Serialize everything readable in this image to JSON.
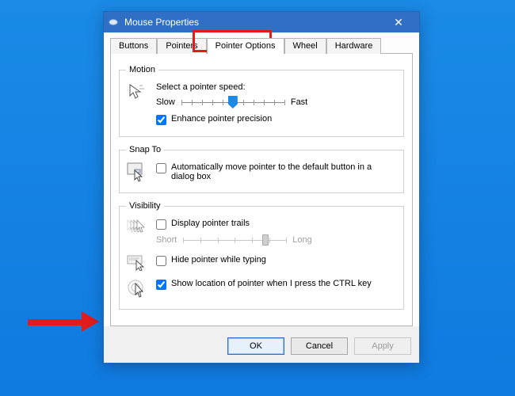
{
  "window": {
    "title": "Mouse Properties",
    "close_glyph": "✕"
  },
  "tabs": {
    "items": [
      {
        "label": "Buttons"
      },
      {
        "label": "Pointers"
      },
      {
        "label": "Pointer Options"
      },
      {
        "label": "Wheel"
      },
      {
        "label": "Hardware"
      }
    ],
    "active_index": 2
  },
  "motion": {
    "legend": "Motion",
    "heading": "Select a pointer speed:",
    "slow": "Slow",
    "fast": "Fast",
    "speed_value": 5,
    "speed_min": 0,
    "speed_max": 10,
    "enhance_label": "Enhance pointer precision",
    "enhance_checked": true
  },
  "snap": {
    "legend": "Snap To",
    "auto_label": "Automatically move pointer to the default button in a dialog box",
    "auto_checked": false
  },
  "visibility": {
    "legend": "Visibility",
    "trails_label": "Display pointer trails",
    "trails_checked": false,
    "short": "Short",
    "long": "Long",
    "trails_value": 8,
    "trails_min": 0,
    "trails_max": 10,
    "hide_label": "Hide pointer while typing",
    "hide_checked": false,
    "ctrl_label": "Show location of pointer when I press the CTRL key",
    "ctrl_checked": true
  },
  "buttons": {
    "ok": "OK",
    "cancel": "Cancel",
    "apply": "Apply"
  }
}
